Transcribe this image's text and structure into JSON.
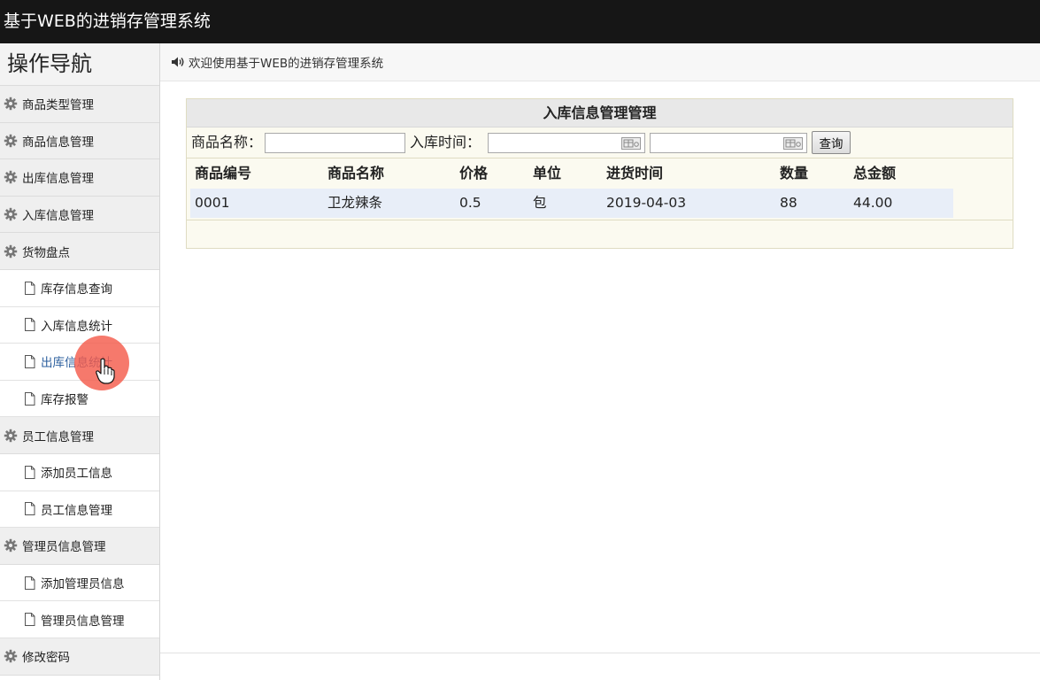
{
  "app": {
    "title": "基于WEB的进销存管理系统"
  },
  "sidebar": {
    "heading": "操作导航",
    "items": [
      {
        "label": "商品类型管理",
        "kind": "group"
      },
      {
        "label": "商品信息管理",
        "kind": "group"
      },
      {
        "label": "出库信息管理",
        "kind": "group"
      },
      {
        "label": "入库信息管理",
        "kind": "group"
      },
      {
        "label": "货物盘点",
        "kind": "group"
      },
      {
        "label": "库存信息查询",
        "kind": "item"
      },
      {
        "label": "入库信息统计",
        "kind": "item"
      },
      {
        "label": "出库信息统计",
        "kind": "item",
        "active": true
      },
      {
        "label": "库存报警",
        "kind": "item"
      },
      {
        "label": "员工信息管理",
        "kind": "group"
      },
      {
        "label": "添加员工信息",
        "kind": "item"
      },
      {
        "label": "员工信息管理",
        "kind": "item"
      },
      {
        "label": "管理员信息管理",
        "kind": "group"
      },
      {
        "label": "添加管理员信息",
        "kind": "item"
      },
      {
        "label": "管理员信息管理",
        "kind": "item"
      },
      {
        "label": "修改密码",
        "kind": "group"
      }
    ]
  },
  "main": {
    "welcome": "欢迎使用基于WEB的进销存管理系统",
    "panel_title": "入库信息管理管理",
    "search": {
      "name_label": "商品名称：",
      "name_value": "",
      "time_label": "入库时间：",
      "start_value": "",
      "end_value": "",
      "query_label": "查询"
    },
    "table": {
      "columns": [
        "商品编号",
        "商品名称",
        "价格",
        "单位",
        "进货时间",
        "数量",
        "总金额"
      ],
      "rows": [
        [
          "0001",
          "卫龙辣条",
          "0.5",
          "包",
          "2019-04-03",
          "88",
          "44.00"
        ]
      ]
    }
  },
  "colors": {
    "topbar": "#161616",
    "active_link": "#2c5f9e",
    "row_highlight": "#e8eef8",
    "click_marker": "#f45c4c"
  },
  "icons": {
    "group": "gear-icon",
    "item": "document-icon",
    "welcome": "speaker-icon",
    "date": "calendar-icon",
    "cursor": "hand-cursor-icon"
  }
}
